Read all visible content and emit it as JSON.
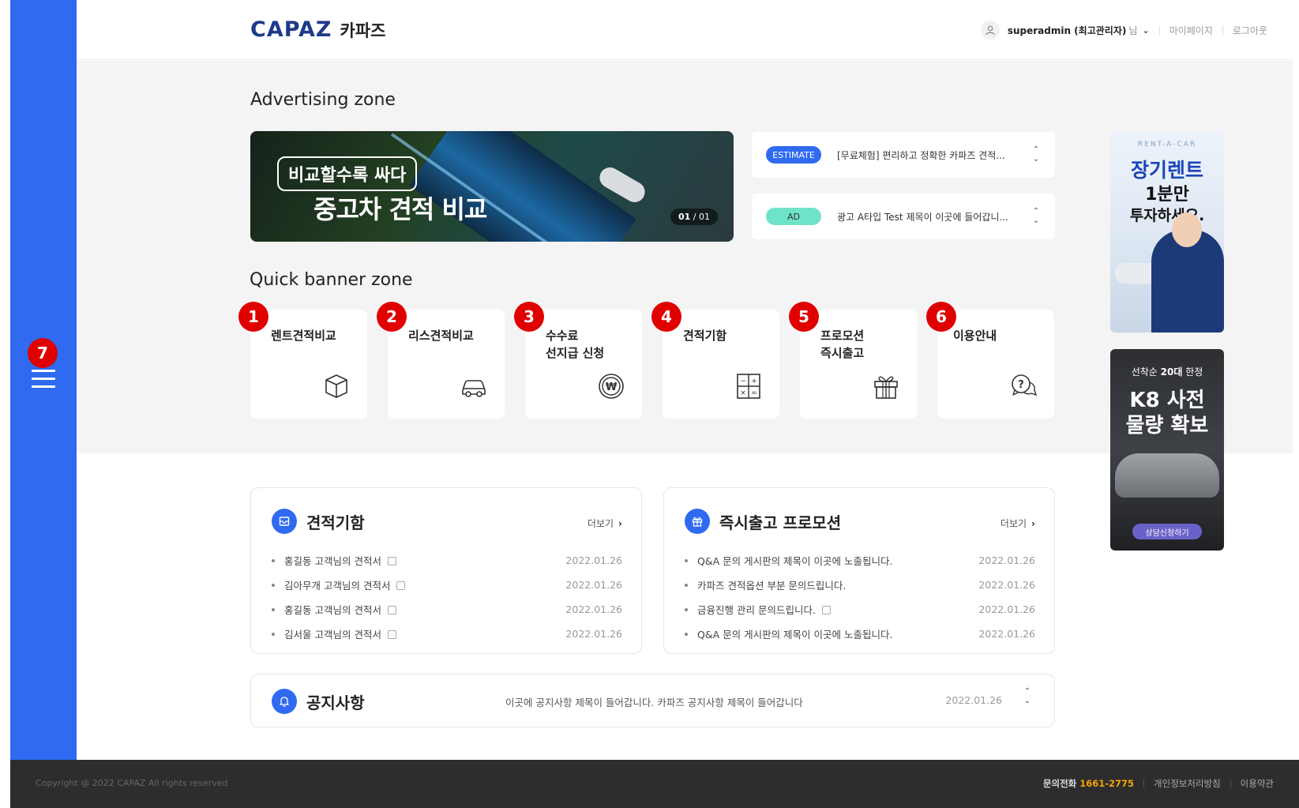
{
  "header": {
    "logo_en": "CAPAZ",
    "logo_ko": "카파즈",
    "user_name": "superadmin (최고관리자)",
    "user_suffix": "님",
    "mypage": "마이페이지",
    "logout": "로그아웃"
  },
  "ad_zone": {
    "title": "Advertising zone",
    "hero": {
      "bubble": "비교할수록 싸다",
      "headline": "중고차 견적 비교",
      "pager_current": "01",
      "pager_sep": "/",
      "pager_total": "01"
    },
    "rows": [
      {
        "tag": "ESTIMATE",
        "text": "[무료체험] 편리하고 정확한 카파즈 견적..."
      },
      {
        "tag": "AD",
        "text": "광고 A타입 Test 제목이 이곳에 들어갑니..."
      }
    ]
  },
  "quick_zone": {
    "title": "Quick banner zone",
    "items": [
      {
        "num": "1",
        "label_1": "렌트견적비교",
        "label_2": "",
        "icon": "box-icon"
      },
      {
        "num": "2",
        "label_1": "리스견적비교",
        "label_2": "",
        "icon": "car-icon"
      },
      {
        "num": "3",
        "label_1": "수수료",
        "label_2": "선지급 신청",
        "icon": "won-coin-icon"
      },
      {
        "num": "4",
        "label_1": "견적기함",
        "label_2": "",
        "icon": "calculator-icon"
      },
      {
        "num": "5",
        "label_1": "프로모션",
        "label_2": "즉시출고",
        "icon": "gift-icon"
      },
      {
        "num": "6",
        "label_1": "이용안내",
        "label_2": "",
        "icon": "question-chat-icon"
      }
    ]
  },
  "side_ads": {
    "ad1": {
      "t1": "RENT-A-CAR",
      "t2": "장기렌트",
      "t3": "1분만",
      "t4": "투자하세요."
    },
    "ad2": {
      "t1_pre": "선착순 ",
      "t1_bold": "20대",
      "t1_post": " 한정",
      "t2": "K8 사전",
      "t3": "물량 확보",
      "btn": "상담신청하기"
    }
  },
  "menu_badge": "7",
  "cards": {
    "estimate": {
      "title": "견적기함",
      "more": "더보기",
      "rows": [
        {
          "text": "홍길동 고객님의 견적서",
          "date": "2022.01.26"
        },
        {
          "text": "김아무개 고객님의 견적서",
          "date": "2022.01.26"
        },
        {
          "text": "홍길동 고객님의 견적서",
          "date": "2022.01.26"
        },
        {
          "text": "김서울 고객님의 견적서",
          "date": "2022.01.26"
        }
      ]
    },
    "promotion": {
      "title": "즉시출고 프로모션",
      "more": "더보기",
      "rows": [
        {
          "text": "Q&A 문의 게시판의 제목이 이곳에 노출됩니다.",
          "date": "2022.01.26"
        },
        {
          "text": "카파즈 견적옵션 부분 문의드립니다.",
          "date": "2022.01.26"
        },
        {
          "text": "금융진행 관리 문의드립니다.",
          "date": "2022.01.26"
        },
        {
          "text": "Q&A 문의 게시판의 제목이 이곳에 노출됩니다.",
          "date": "2022.01.26"
        }
      ]
    }
  },
  "notice": {
    "title": "공지사항",
    "text": "이곳에 공지사항 제목이 들어갑니다. 카파즈 공지사항 제목이 들어갑니다",
    "date": "2022.01.26"
  },
  "footer": {
    "copyright": "Copyright @ 2022 CAPAZ All rights reserved",
    "phone_label": "문의전화",
    "phone": "1661-2775",
    "privacy": "개인정보처리방침",
    "terms": "이용약관"
  },
  "colors": {
    "accent": "#2f6af0",
    "badge": "#e00000",
    "phone": "#f6a600",
    "footer_bg": "#2d2d2d"
  }
}
